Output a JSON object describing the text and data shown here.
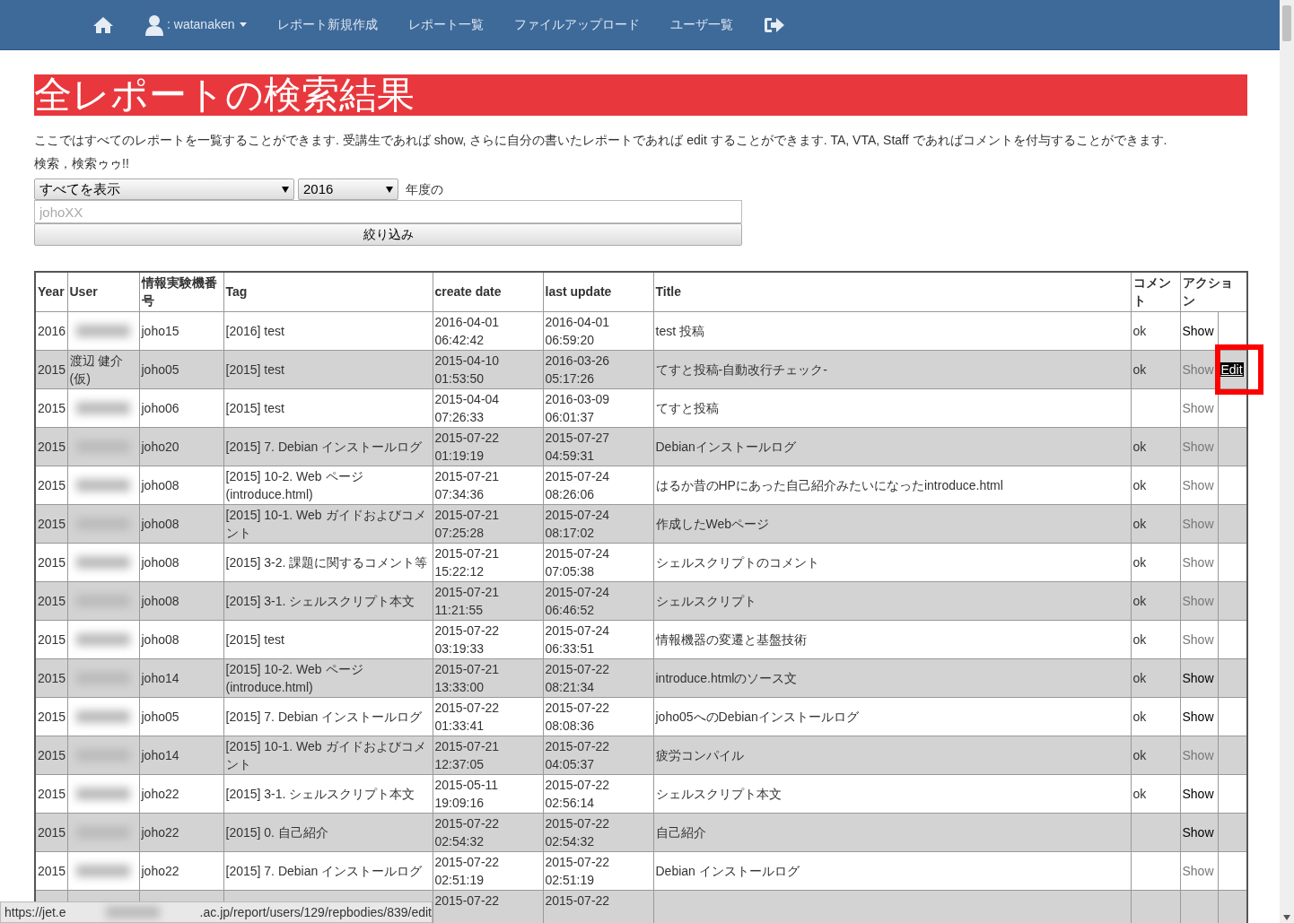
{
  "navbar": {
    "user": ": watanaken",
    "items": [
      "レポート新規作成",
      "レポート一覧",
      "ファイルアップロード",
      "ユーザ一覧"
    ]
  },
  "heading": "全レポートの検索結果",
  "description": "ここではすべてのレポートを一覧することができます. 受講生であれば show, さらに自分の書いたレポートであれば edit することができます. TA, VTA, Staff であればコメントを付与することができます.",
  "subtext": "検索，検索ゥゥ!!",
  "filter": {
    "category": "すべてを表示",
    "year": "2016",
    "year_suffix": "年度の",
    "search_placeholder": "johoXX",
    "submit": "絞り込み"
  },
  "table": {
    "columns": [
      "Year",
      "User",
      "情報実験機番号",
      "Tag",
      "create date",
      "last update",
      "Title",
      "コメント",
      "アクション"
    ],
    "rows": [
      {
        "year": "2016",
        "user": null,
        "machine": "joho15",
        "tag": "[2016] test",
        "created": [
          "2016-04-01",
          "06:42:42"
        ],
        "updated": [
          "2016-04-01",
          "06:59:20"
        ],
        "title": "test 投稿",
        "comment": "ok",
        "show": "Show",
        "show_visited": false,
        "edit": null
      },
      {
        "year": "2015",
        "user": "渡辺 健介 (仮)",
        "machine": "joho05",
        "tag": "[2015] test",
        "created": [
          "2015-04-10",
          "01:53:50"
        ],
        "updated": [
          "2016-03-26",
          "05:17:26"
        ],
        "title": "てすと投稿-自動改行チェック-",
        "comment": "ok",
        "show": "Show",
        "show_visited": true,
        "edit": "Edit",
        "edit_highlighted": true
      },
      {
        "year": "2015",
        "user": null,
        "machine": "joho06",
        "tag": "[2015] test",
        "created": [
          "2015-04-04",
          "07:26:33"
        ],
        "updated": [
          "2016-03-09",
          "06:01:37"
        ],
        "title": "てすと投稿",
        "comment": null,
        "show": "Show",
        "show_visited": true,
        "edit": null
      },
      {
        "year": "2015",
        "user": null,
        "machine": "joho20",
        "tag": "[2015] 7. Debian インストールログ",
        "created": [
          "2015-07-22",
          "01:19:19"
        ],
        "updated": [
          "2015-07-27",
          "04:59:31"
        ],
        "title": "Debianインストールログ",
        "comment": "ok",
        "show": "Show",
        "show_visited": true,
        "edit": null
      },
      {
        "year": "2015",
        "user": null,
        "machine": "joho08",
        "tag": "[2015] 10-2. Web ページ (introduce.html)",
        "created": [
          "2015-07-21",
          "07:34:36"
        ],
        "updated": [
          "2015-07-24",
          "08:26:06"
        ],
        "title": "はるか昔のHPにあった自己紹介みたいになったintroduce.html",
        "comment": "ok",
        "show": "Show",
        "show_visited": true,
        "edit": null
      },
      {
        "year": "2015",
        "user": null,
        "machine": "joho08",
        "tag": "[2015] 10-1. Web ガイドおよびコメント",
        "created": [
          "2015-07-21",
          "07:25:28"
        ],
        "updated": [
          "2015-07-24",
          "08:17:02"
        ],
        "title": "作成したWebページ",
        "comment": "ok",
        "show": "Show",
        "show_visited": true,
        "edit": null
      },
      {
        "year": "2015",
        "user": null,
        "machine": "joho08",
        "tag": "[2015] 3-2. 課題に関するコメント等",
        "created": [
          "2015-07-21",
          "15:22:12"
        ],
        "updated": [
          "2015-07-24",
          "07:05:38"
        ],
        "title": "シェルスクリプトのコメント",
        "comment": "ok",
        "show": "Show",
        "show_visited": true,
        "edit": null
      },
      {
        "year": "2015",
        "user": null,
        "machine": "joho08",
        "tag": "[2015] 3-1. シェルスクリプト本文",
        "created": [
          "2015-07-21",
          "11:21:55"
        ],
        "updated": [
          "2015-07-24",
          "06:46:52"
        ],
        "title": "シェルスクリプト",
        "comment": "ok",
        "show": "Show",
        "show_visited": true,
        "edit": null
      },
      {
        "year": "2015",
        "user": null,
        "machine": "joho08",
        "tag": "[2015] test",
        "created": [
          "2015-07-22",
          "03:19:33"
        ],
        "updated": [
          "2015-07-24",
          "06:33:51"
        ],
        "title": "情報機器の変遷と基盤技術",
        "comment": "ok",
        "show": "Show",
        "show_visited": true,
        "edit": null
      },
      {
        "year": "2015",
        "user": null,
        "machine": "joho14",
        "tag": "[2015] 10-2. Web ページ (introduce.html)",
        "created": [
          "2015-07-21",
          "13:33:00"
        ],
        "updated": [
          "2015-07-22",
          "08:21:34"
        ],
        "title": "introduce.htmlのソース文",
        "comment": "ok",
        "show": "Show",
        "show_visited": false,
        "edit": null
      },
      {
        "year": "2015",
        "user": null,
        "machine": "joho05",
        "tag": "[2015] 7. Debian インストールログ",
        "created": [
          "2015-07-22",
          "01:33:41"
        ],
        "updated": [
          "2015-07-22",
          "08:08:36"
        ],
        "title": "joho05へのDebianインストールログ",
        "comment": "ok",
        "show": "Show",
        "show_visited": false,
        "edit": null
      },
      {
        "year": "2015",
        "user": null,
        "machine": "joho14",
        "tag": "[2015] 10-1. Web ガイドおよびコメント",
        "created": [
          "2015-07-21",
          "12:37:05"
        ],
        "updated": [
          "2015-07-22",
          "04:05:37"
        ],
        "title": "疲労コンパイル",
        "comment": "ok",
        "show": "Show",
        "show_visited": true,
        "edit": null
      },
      {
        "year": "2015",
        "user": null,
        "machine": "joho22",
        "tag": "[2015] 3-1. シェルスクリプト本文",
        "created": [
          "2015-05-11",
          "19:09:16"
        ],
        "updated": [
          "2015-07-22",
          "02:56:14"
        ],
        "title": "シェルスクリプト本文",
        "comment": "ok",
        "show": "Show",
        "show_visited": false,
        "edit": null
      },
      {
        "year": "2015",
        "user": null,
        "machine": "joho22",
        "tag": "[2015] 0. 自己紹介",
        "created": [
          "2015-07-22",
          "02:54:32"
        ],
        "updated": [
          "2015-07-22",
          "02:54:32"
        ],
        "title": "自己紹介",
        "comment": null,
        "show": "Show",
        "show_visited": false,
        "edit": null
      },
      {
        "year": "2015",
        "user": null,
        "machine": "joho22",
        "tag": "[2015] 7. Debian インストールログ",
        "created": [
          "2015-07-22",
          "02:51:19"
        ],
        "updated": [
          "2015-07-22",
          "02:51:19"
        ],
        "title": "Debian インストールログ",
        "comment": null,
        "show": "Show",
        "show_visited": true,
        "edit": null
      },
      {
        "year": null,
        "user": null,
        "machine": null,
        "tag": null,
        "created": [
          "2015-07-22"
        ],
        "updated": [
          "2015-07-22"
        ],
        "title": null,
        "comment": null,
        "show": null,
        "edit": null
      }
    ]
  },
  "status_bar": {
    "url_start": "https://jet.e",
    "url_end": ".ac.jp/report/users/129/repbodies/839/edit"
  }
}
